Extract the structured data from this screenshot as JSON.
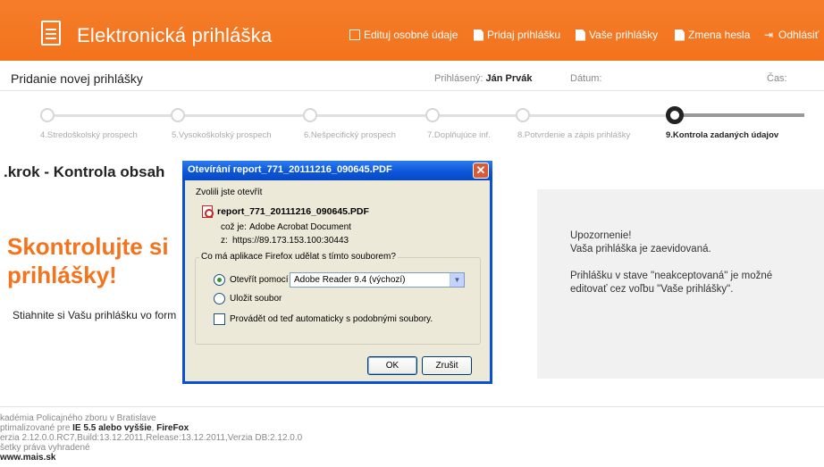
{
  "header": {
    "app_title": "Elektronická prihláška",
    "nav": [
      {
        "label": "Edituj osobné údaje",
        "icon": "edit-icon"
      },
      {
        "label": "Pridaj prihlášku",
        "icon": "add-document-icon"
      },
      {
        "label": "Vaše prihlášky",
        "icon": "documents-icon"
      },
      {
        "label": "Zmena hesla",
        "icon": "password-icon"
      },
      {
        "label": "Odhlásiť",
        "icon": "logout-icon"
      }
    ]
  },
  "subheader": {
    "page_title": "Pridanie novej prihlášky",
    "logged_in_label": "Prihlásený:",
    "logged_in_user": "Ján Prvák",
    "date_label": "Dátum:",
    "time_label": "Čas:"
  },
  "steps": [
    {
      "label": "4.Stredoškolský prospech"
    },
    {
      "label": "5.Vysokoškolský prospech"
    },
    {
      "label": "6.Nešpecifický prospech"
    },
    {
      "label": "7.Doplňujúce inf."
    },
    {
      "label": "8.Potvrdenie a zápis prihlášky"
    },
    {
      "label": "9.Kontrola zadaných údajov"
    }
  ],
  "main": {
    "step_title": ".krok - Kontrola obsah",
    "headline_line1": "Skontrolujte si",
    "headline_line2": "prihlášky!",
    "download_text": "Stiahnite si Vašu prihlášku vo form"
  },
  "notice": {
    "line1": "Upozornenie!",
    "line2": "Vaša prihláška je zaevidovaná.",
    "line3": "Prihlášku v stave \"neakceptovaná\" je možné",
    "line4": "editovať cez voľbu \"Vaše prihlášky\"."
  },
  "footer": {
    "line1": "kadémia Policajného zboru v Bratislave",
    "line2_prefix": "ptimalizované pre ",
    "line2_bold": "IE 5.5 alebo vyššie",
    "line2_sep": ", ",
    "line2_bold2": "FireFox",
    "line3": "erzia 2.12.0.0.RC7,Build:13.12.2011,Release:13.12.2011,Verzia DB:2.12.0.0",
    "line4": "šetky práva vyhradené",
    "line5": "www.mais.sk"
  },
  "dialog": {
    "title": "Otevírání report_771_20111216_090645.PDF",
    "close": "✕",
    "intro": "Zvolili jste otevřít",
    "filename": "report_771_20111216_090645.PDF",
    "type_label": "což je:",
    "type_value": "Adobe Acrobat Document",
    "from_label": "z:",
    "from_value": "https://89.173.153.100:30443",
    "question": "Co má aplikace Firefox udělat s tímto souborem?",
    "open_with": "Otevřít pomocí",
    "open_with_app": "Adobe Reader 9.4 (výchozí)",
    "save_file": "Uložit soubor",
    "auto": "Provádět od teď automaticky s podobnými soubory.",
    "ok": "OK",
    "cancel": "Zrušit"
  }
}
